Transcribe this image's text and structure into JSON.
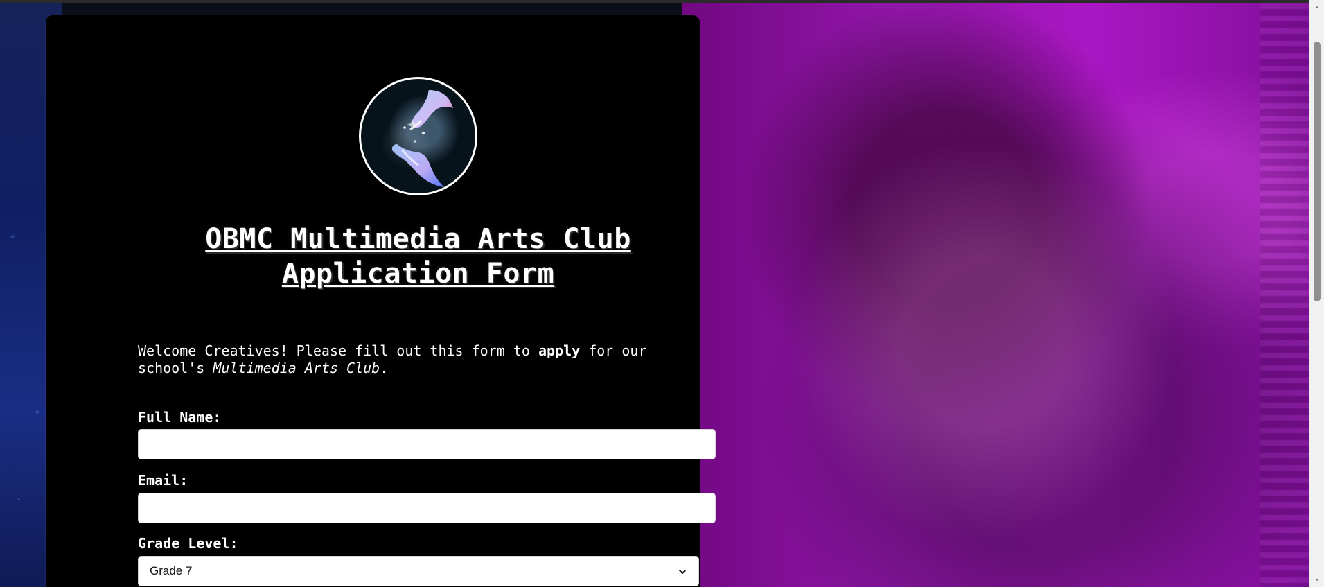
{
  "form": {
    "title_line1": "OBMC Multimedia Arts Club",
    "title_line2": "Application Form",
    "intro_part1": "Welcome Creatives! Please fill out this form to ",
    "intro_bold": "apply",
    "intro_part2": " for our school's ",
    "intro_italic": "Multimedia Arts Club",
    "intro_end": ".",
    "fields": {
      "full_name": {
        "label": "Full Name:",
        "value": ""
      },
      "email": {
        "label": "Email:",
        "value": ""
      },
      "grade_level": {
        "label": "Grade Level:",
        "selected": "Grade 7"
      }
    }
  },
  "colors": {
    "card_bg": "#000000",
    "text": "#ffffff",
    "accent_blue": "#1a2d84",
    "accent_purple": "#a11bb8"
  },
  "icons": {
    "logo": "hands-sparkle-logo",
    "select_chevron": "chevron-down-icon",
    "scroll_up": "scroll-up-icon",
    "scroll_down": "scroll-down-icon"
  }
}
